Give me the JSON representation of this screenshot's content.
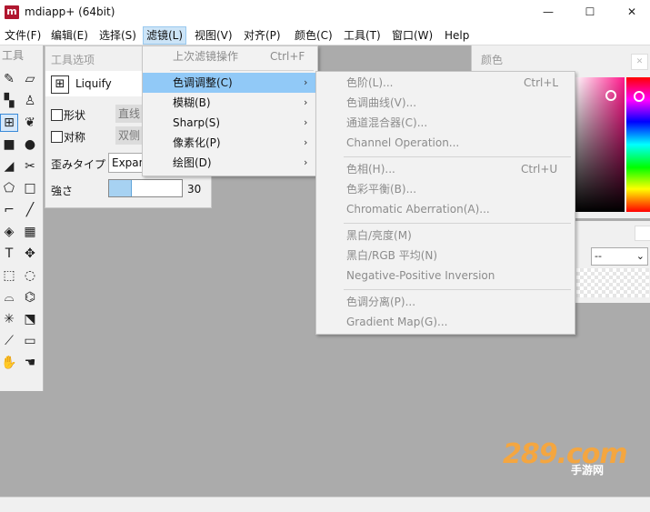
{
  "window": {
    "title": "mdiapp+ (64bit)",
    "logo": "m",
    "minimize": "—",
    "maximize": "☐",
    "close": "✕"
  },
  "menubar": [
    "文件(F)",
    "编辑(E)",
    "选择(S)",
    "滤镜(L)",
    "视图(V)",
    "对齐(P)",
    "颜色(C)",
    "工具(T)",
    "窗口(W)",
    "Help"
  ],
  "tool_panel": {
    "title": "工具"
  },
  "tool_options": {
    "title": "工具选项",
    "tool_name": "Liquify",
    "shape_label": "形状",
    "shape_value": "直线",
    "symmetry_label": "对称",
    "symmetry_value": "双侧",
    "distort_label": "歪みタイプ",
    "distort_value": "Expans",
    "strength_label": "強さ",
    "strength_value": "30",
    "strength_fraction": 0.3
  },
  "color_panel": {
    "title": "颜色"
  },
  "layer_panel": {
    "dropdown_value": "--"
  },
  "filter_menu": {
    "items": [
      {
        "label": "上次滤镜操作",
        "shortcut": "Ctrl+F",
        "disabled": true
      },
      {
        "label": "色调调整(C)",
        "submenu": true,
        "highlighted": true
      },
      {
        "label": "模糊(B)",
        "submenu": true
      },
      {
        "label": "Sharp(S)",
        "submenu": true
      },
      {
        "label": "像素化(P)",
        "submenu": true
      },
      {
        "label": "绘图(D)",
        "submenu": true
      }
    ]
  },
  "color_adjust_submenu": {
    "items": [
      {
        "label": "色阶(L)...",
        "shortcut": "Ctrl+L"
      },
      {
        "label": "色调曲线(V)..."
      },
      {
        "label": "通道混合器(C)..."
      },
      {
        "label": "Channel Operation..."
      },
      {
        "label": "色相(H)...",
        "shortcut": "Ctrl+U"
      },
      {
        "label": "色彩平衡(B)..."
      },
      {
        "label": "Chromatic Aberration(A)..."
      },
      {
        "label": "黑白/亮度(M)"
      },
      {
        "label": "黑白/RGB 平均(N)"
      },
      {
        "label": "Negative-Positive Inversion"
      },
      {
        "label": "色调分离(P)..."
      },
      {
        "label": "Gradient Map(G)..."
      }
    ]
  },
  "watermark": {
    "brand": "289.com",
    "sub": "手游网"
  },
  "colors": {
    "highlight": "#91c9f7",
    "menu_active": "#cce4f7",
    "accent_red": "#b0172f",
    "watermark": "#f4a640"
  }
}
